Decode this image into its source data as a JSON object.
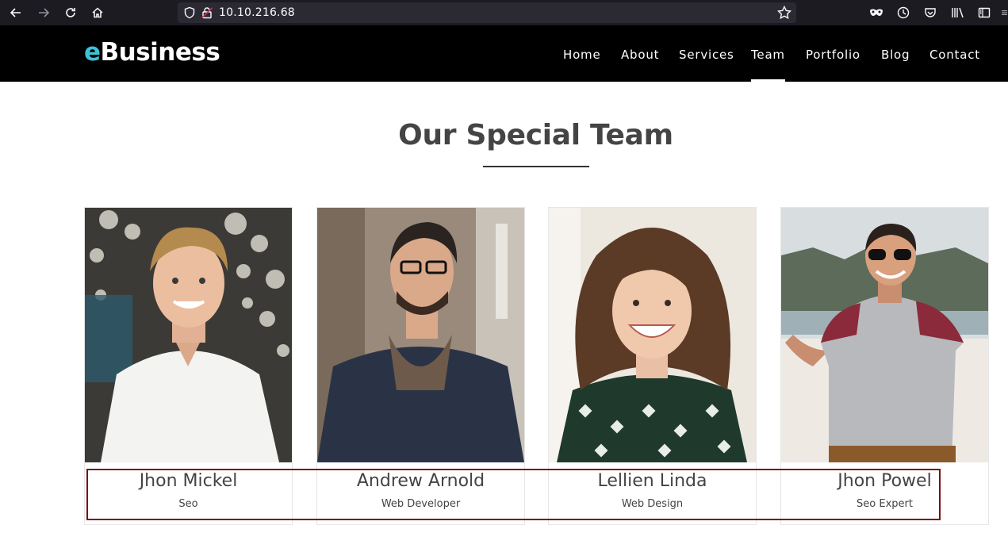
{
  "browser": {
    "url": "10.10.216.68"
  },
  "site": {
    "logo_accent": "e",
    "logo_rest": "Business",
    "accent_color": "#3ec1d5",
    "menu": [
      {
        "label": "Home"
      },
      {
        "label": "About"
      },
      {
        "label": "Services"
      },
      {
        "label": "Team",
        "active": true
      },
      {
        "label": "Portfolio"
      },
      {
        "label": "Blog"
      },
      {
        "label": "Contact"
      }
    ]
  },
  "team_section": {
    "title": "Our Special Team",
    "members": [
      {
        "name": "Jhon Mickel",
        "role": "Seo",
        "photo_icon": "man-white-shirt-photo"
      },
      {
        "name": "Andrew Arnold",
        "role": "Web Developer",
        "photo_icon": "man-glasses-jacket-photo"
      },
      {
        "name": "Lellien Linda",
        "role": "Web Design",
        "photo_icon": "woman-curly-hair-photo"
      },
      {
        "name": "Jhon Powel",
        "role": "Seo Expert",
        "photo_icon": "man-sunglasses-tshirt-photo"
      }
    ]
  },
  "annotation": {
    "highlight_color": "#7a0f13"
  }
}
